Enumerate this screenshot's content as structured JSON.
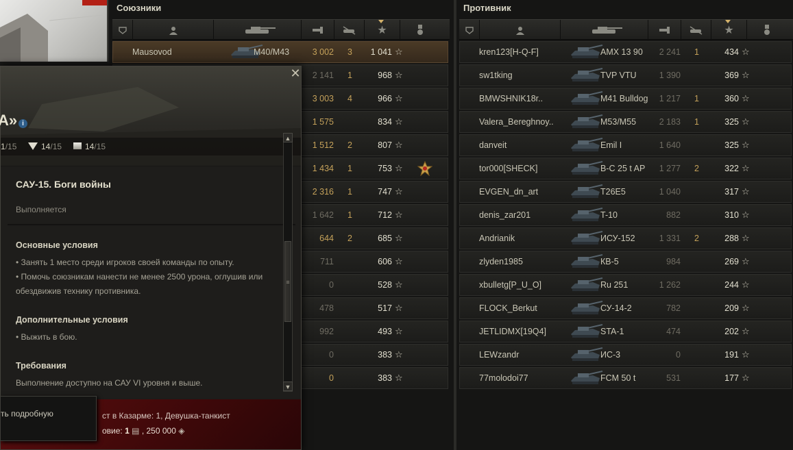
{
  "allies": {
    "title": "Союзники",
    "rows": [
      {
        "name": "Mausovod",
        "vehicle": "M40/M43",
        "damage": "3 002",
        "kills": "3",
        "exp": "1 041",
        "self": true,
        "dim": false
      },
      {
        "name": "",
        "vehicle": "",
        "damage": "2 141",
        "kills": "1",
        "exp": "968",
        "dim": true
      },
      {
        "name": "",
        "vehicle": "",
        "damage": "3 003",
        "kills": "4",
        "exp": "966",
        "dim": false
      },
      {
        "name": "",
        "vehicle": "",
        "damage": "1 575",
        "kills": "",
        "exp": "834",
        "dim": false
      },
      {
        "name": "",
        "vehicle": "",
        "damage": "1 512",
        "kills": "2",
        "exp": "807",
        "dim": false
      },
      {
        "name": "",
        "vehicle": "",
        "damage": "1 434",
        "kills": "1",
        "exp": "753",
        "dim": false,
        "medal": true
      },
      {
        "name": "",
        "vehicle": "",
        "damage": "2 316",
        "kills": "1",
        "exp": "747",
        "dim": false
      },
      {
        "name": "",
        "vehicle": "",
        "damage": "1 642",
        "kills": "1",
        "exp": "712",
        "dim": true
      },
      {
        "name": "",
        "vehicle": "",
        "damage": "644",
        "kills": "2",
        "exp": "685",
        "dim": false
      },
      {
        "name": "",
        "vehicle": "",
        "damage": "711",
        "kills": "",
        "exp": "606",
        "dim": true
      },
      {
        "name": "",
        "vehicle": "",
        "damage": "0",
        "kills": "",
        "exp": "528",
        "dim": true
      },
      {
        "name": "",
        "vehicle": "",
        "damage": "478",
        "kills": "",
        "exp": "517",
        "dim": true
      },
      {
        "name": "",
        "vehicle": "",
        "damage": "992",
        "kills": "",
        "exp": "493",
        "dim": true
      },
      {
        "name": "",
        "vehicle": "",
        "damage": "0",
        "kills": "",
        "exp": "383",
        "dim": true
      },
      {
        "name": "",
        "vehicle": "",
        "damage": "0",
        "kills": "",
        "exp": "383",
        "dim": false
      }
    ]
  },
  "enemies": {
    "title": "Противник",
    "rows": [
      {
        "name": "kren123[H-Q-F]",
        "vehicle": "AMX 13 90",
        "damage": "2 241",
        "kills": "1",
        "exp": "434"
      },
      {
        "name": "sw1tking",
        "vehicle": "TVP VTU",
        "damage": "1 390",
        "kills": "",
        "exp": "369"
      },
      {
        "name": "BMWSHNIK18r..",
        "vehicle": "M41 Bulldog",
        "damage": "1 217",
        "kills": "1",
        "exp": "360"
      },
      {
        "name": "Valera_Bereghnoy..",
        "vehicle": "M53/M55",
        "damage": "2 183",
        "kills": "1",
        "exp": "325"
      },
      {
        "name": "danveit",
        "vehicle": "Emil I",
        "damage": "1 640",
        "kills": "",
        "exp": "325"
      },
      {
        "name": "tor000[SHECK]",
        "vehicle": "B-C 25 t AP",
        "damage": "1 277",
        "kills": "2",
        "exp": "322"
      },
      {
        "name": "EVGEN_dn_art",
        "vehicle": "T26E5",
        "damage": "1 040",
        "kills": "",
        "exp": "317"
      },
      {
        "name": "denis_zar201",
        "vehicle": "T-10",
        "damage": "882",
        "kills": "",
        "exp": "310"
      },
      {
        "name": "Andrianik",
        "vehicle": "ИСУ-152",
        "damage": "1 331",
        "kills": "2",
        "exp": "288"
      },
      {
        "name": "zlyden1985",
        "vehicle": "КВ-5",
        "damage": "984",
        "kills": "",
        "exp": "269"
      },
      {
        "name": "xbulletg[P_U_O]",
        "vehicle": "Ru 251",
        "damage": "1 262",
        "kills": "",
        "exp": "244"
      },
      {
        "name": "FLOCK_Berkut",
        "vehicle": "СУ-14-2",
        "damage": "782",
        "kills": "",
        "exp": "209"
      },
      {
        "name": "JETLIDMX[19Q4]",
        "vehicle": "STA-1",
        "damage": "474",
        "kills": "",
        "exp": "202"
      },
      {
        "name": "LEWzandr",
        "vehicle": "ИС-3",
        "damage": "0",
        "kills": "",
        "exp": "191"
      },
      {
        "name": "77molodoi77",
        "vehicle": "FCM 50 t",
        "damage": "531",
        "kills": "",
        "exp": "177"
      }
    ]
  },
  "popup": {
    "title_fragment": "А»",
    "progress": [
      {
        "done": "1",
        "total": "/15"
      },
      {
        "done": "14",
        "total": "/15"
      },
      {
        "done": "14",
        "total": "/15"
      }
    ],
    "mission_name": "САУ-15. Боги войны",
    "status": "Выполняется",
    "main_title": "Основные условия",
    "main_line1": "• Занять 1 место среди игроков своей команды по опыту.",
    "main_line2": "• Помочь союзникам нанести не менее 2500 урона, оглушив или обездвижив технику противника.",
    "extra_title": "Дополнительные условия",
    "extra_line1": "• Выжить в бою.",
    "req_title": "Требования",
    "req_line1": "Выполнение доступно на САУ VI уровня и выше.",
    "award_line1": "ст в Казарме: 1, Девушка-танкист",
    "award_line2_label": "овие:",
    "award_line2_value": "1",
    "award_line2_credits": ", 250 000",
    "tooltip_text": "ть подробную"
  },
  "colors": {
    "gold": "#c4a15a",
    "self_row": "#4a3a26",
    "footer_red": "#5a0d0e"
  }
}
